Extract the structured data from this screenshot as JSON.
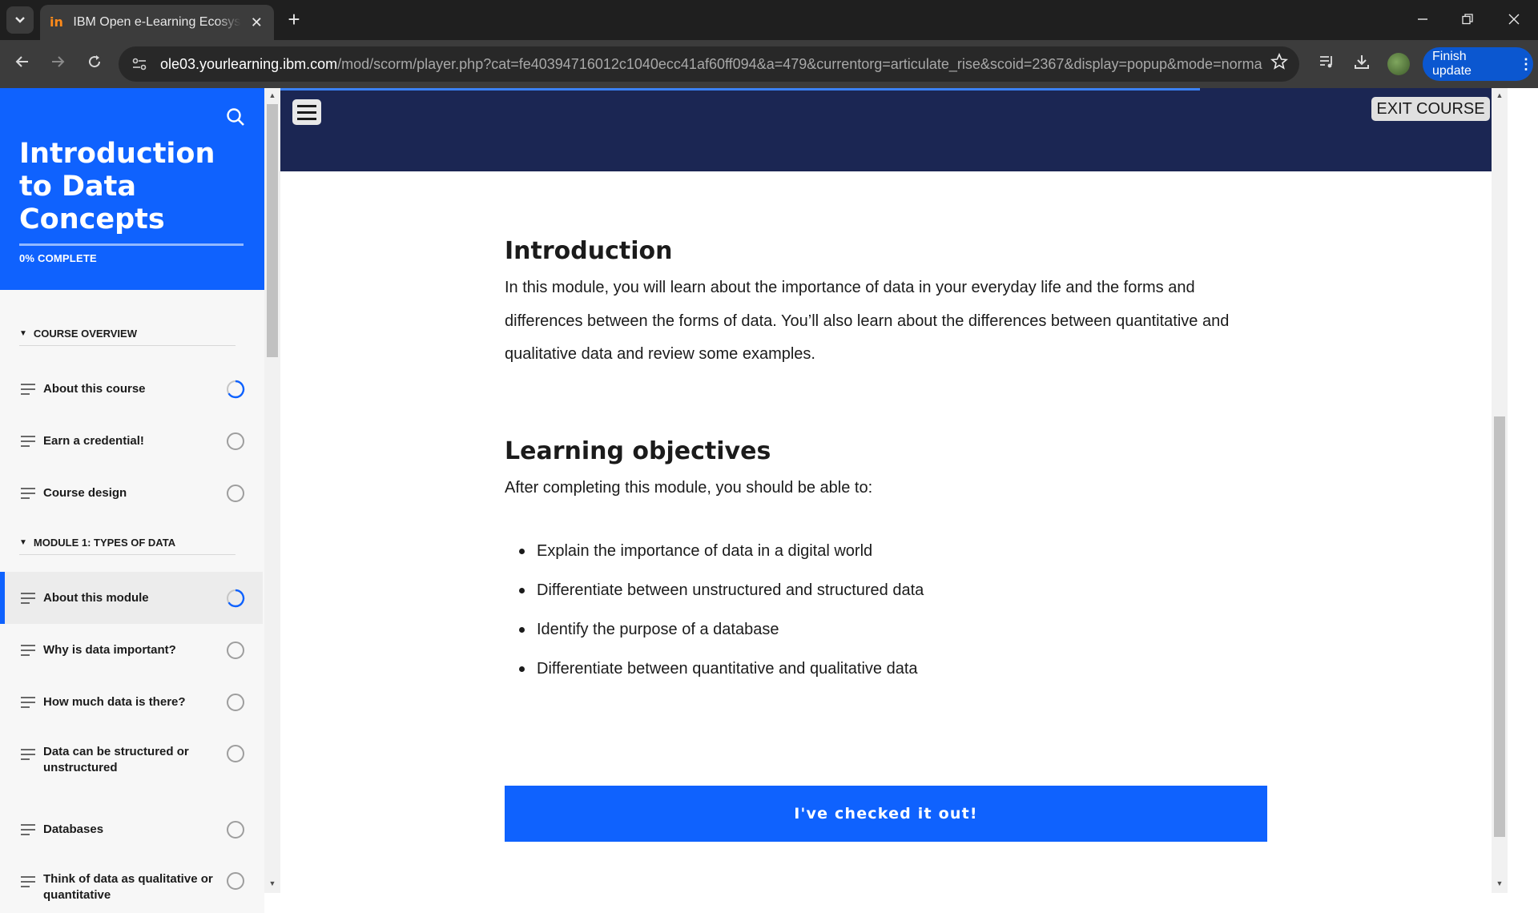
{
  "browser": {
    "tab_title": "IBM Open e-Learning Ecosystem",
    "tab_close": "✕",
    "new_tab": "+",
    "url_domain": "ole03.yourlearning.ibm.com",
    "url_path": "/mod/scorm/player.php?cat=fe40394716012c1040ecc41af60ff094&a=479&currentorg=articulate_rise&scoid=2367&display=popup&mode=norma...",
    "finish_update": "Finish update",
    "menu_dots": "⋮",
    "accent": "#0b57d0"
  },
  "sidebar": {
    "course_title": "Introduction to Data Concepts",
    "progress_label": "0% COMPLETE",
    "progress_value": 0,
    "sections": [
      {
        "title": "COURSE OVERVIEW",
        "items": [
          {
            "label": "About this course",
            "status": "in-progress"
          },
          {
            "label": "Earn a credential!",
            "status": "not-started"
          },
          {
            "label": "Course design",
            "status": "not-started"
          }
        ]
      },
      {
        "title": "MODULE 1: TYPES OF DATA",
        "items": [
          {
            "label": "About this module",
            "status": "in-progress",
            "active": true
          },
          {
            "label": "Why is data important?",
            "status": "not-started"
          },
          {
            "label": "How much data is there?",
            "status": "not-started"
          },
          {
            "label": "Data can be structured or unstructured",
            "status": "not-started"
          },
          {
            "label": "Databases",
            "status": "not-started"
          },
          {
            "label": "Think of data as qualitative or quantitative",
            "status": "not-started"
          }
        ]
      }
    ],
    "brand_color": "#0f62fe"
  },
  "header": {
    "exit_label": "EXIT COURSE",
    "hero_color": "#1b2653"
  },
  "main": {
    "intro_heading": "Introduction",
    "intro_text": "In this module, you will learn about the importance of data in your everyday life and the forms and differences between the forms of data. You’ll also learn about the differences between quantitative and qualitative data and review some examples.",
    "objectives_heading": "Learning objectives",
    "objectives_lead": "After completing this module, you should be able to:",
    "objectives": [
      "Explain the importance of data in a digital world",
      "Differentiate between unstructured and structured data",
      "Identify the purpose of a database",
      "Differentiate between quantitative and qualitative data"
    ],
    "cta_label": "I've checked it out!"
  }
}
